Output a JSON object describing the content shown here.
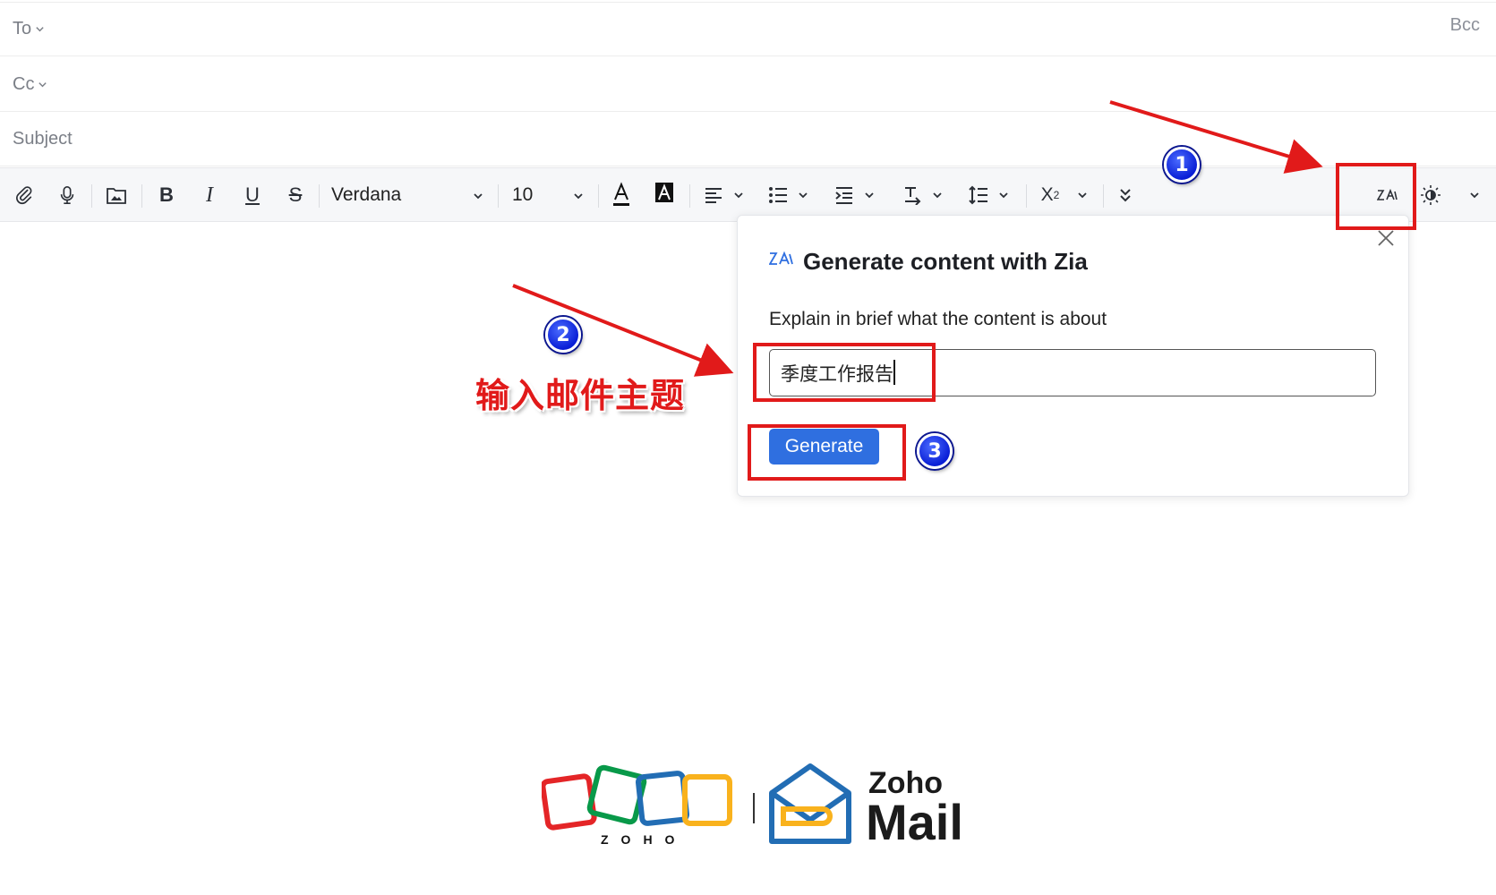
{
  "compose": {
    "to_label": "To",
    "cc_label": "Cc",
    "bcc_label": "Bcc",
    "subject_placeholder": "Subject"
  },
  "toolbar": {
    "font_family": "Verdana",
    "font_size": "10",
    "icons": [
      "paperclip-icon",
      "microphone-icon",
      "insert-image-icon",
      "bold-icon",
      "italic-icon",
      "underline-icon",
      "strikethrough-icon",
      "text-color-icon",
      "highlight-color-icon",
      "align-left-icon",
      "bullet-list-icon",
      "indent-icon",
      "text-direction-icon",
      "line-spacing-icon",
      "superscript-icon",
      "more-options-icon",
      "zia-icon",
      "theme-toggle-icon"
    ]
  },
  "zia_popup": {
    "title": "Generate content with Zia",
    "prompt_label": "Explain in brief what the content is about",
    "prompt_value": "季度工作报告",
    "generate_label": "Generate"
  },
  "annotations": {
    "step1": "1",
    "step2": "2",
    "step3": "3",
    "step2_text": "输入邮件主题"
  },
  "branding": {
    "zoho_wordmark": "ZOHO",
    "product_line1": "Zoho",
    "product_line2": "Mail"
  },
  "colors": {
    "accent": "#2f6fe0",
    "annotation_red": "#e11a1a",
    "badge_blue": "#0a1fd6"
  }
}
